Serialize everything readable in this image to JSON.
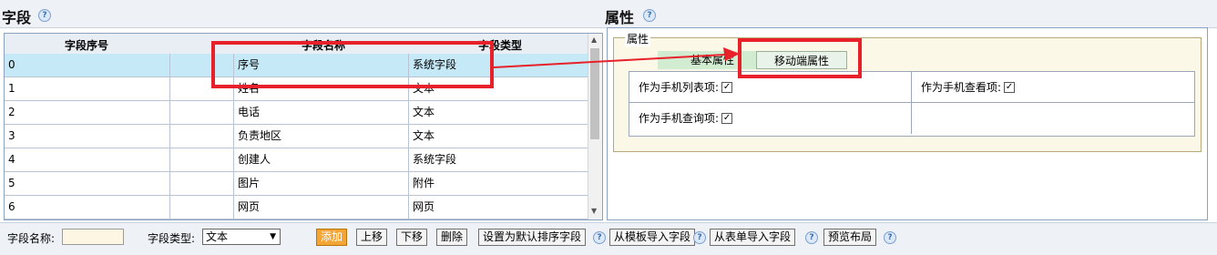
{
  "left": {
    "title": "字段",
    "headers": [
      "字段序号",
      "字段名称",
      "字段类型"
    ],
    "rows": [
      {
        "index": "0",
        "name": "序号",
        "type": "系统字段"
      },
      {
        "index": "1",
        "name": "姓名",
        "type": "文本"
      },
      {
        "index": "2",
        "name": "电话",
        "type": "文本"
      },
      {
        "index": "3",
        "name": "负责地区",
        "type": "文本"
      },
      {
        "index": "4",
        "name": "创建人",
        "type": "系统字段"
      },
      {
        "index": "5",
        "name": "图片",
        "type": "附件"
      },
      {
        "index": "6",
        "name": "网页",
        "type": "网页"
      }
    ]
  },
  "right": {
    "title": "属性",
    "legend": "属性",
    "tab_basic": "基本属性",
    "tab_mobile": "移动端属性",
    "props": {
      "mobile_list": "作为手机列表项:",
      "mobile_view": "作为手机查看项:",
      "mobile_query": "作为手机查询项:"
    }
  },
  "toolbar": {
    "field_name_label": "字段名称:",
    "field_name_value": "",
    "field_type_label": "字段类型:",
    "field_type_value": "文本",
    "add": "添加",
    "up": "上移",
    "down": "下移",
    "delete": "删除",
    "set_default_sort": "设置为默认排序字段",
    "import_template": "从模板导入字段",
    "import_form": "从表单导入字段",
    "preview_layout": "预览布局"
  },
  "colors": {
    "selected_row": "#c6e9f7",
    "annotation_red": "#e8202a",
    "add_button": "#f3a536"
  }
}
